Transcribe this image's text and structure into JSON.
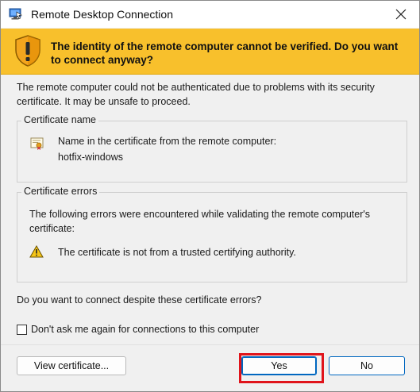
{
  "window": {
    "title": "Remote Desktop Connection"
  },
  "banner": {
    "message": "The identity of the remote computer cannot be verified. Do you want to connect anyway?",
    "color": "#f8c02c"
  },
  "intro": "The remote computer could not be authenticated due to problems with its security certificate. It may be unsafe to proceed.",
  "certificate": {
    "group_title": "Certificate name",
    "label": "Name in the certificate from the remote computer:",
    "name": "hotfix-windows"
  },
  "errors": {
    "group_title": "Certificate errors",
    "intro": "The following errors were encountered while validating the remote computer's certificate:",
    "items": [
      "The certificate is not from a trusted certifying authority."
    ]
  },
  "question": "Do you want to connect despite these certificate errors?",
  "dont_ask": {
    "label": "Don't ask me again for connections to this computer",
    "checked": false
  },
  "buttons": {
    "view_certificate": "View certificate...",
    "yes": "Yes",
    "no": "No"
  },
  "highlight_color": "#e0141b"
}
